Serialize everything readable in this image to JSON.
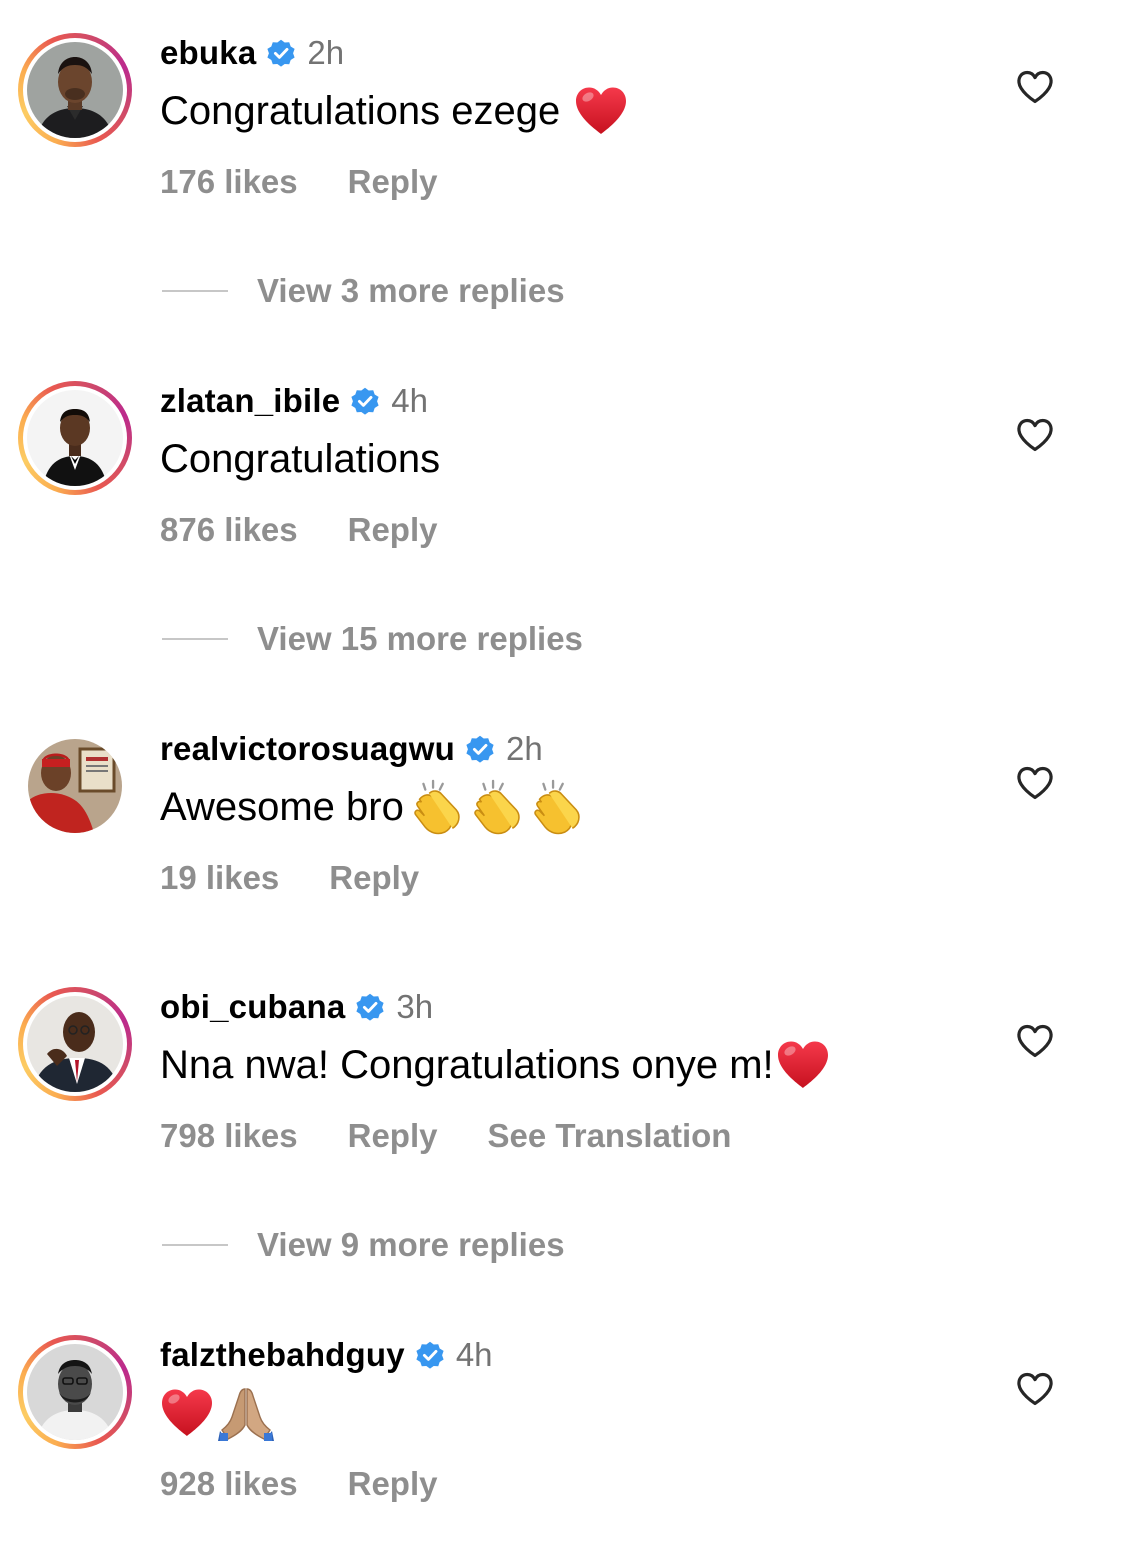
{
  "comments": [
    {
      "username": "ebuka",
      "time": "2h",
      "text": "Congratulations ezege",
      "likes": "176 likes",
      "reply_label": "Reply",
      "view_replies": "View 3 more replies"
    },
    {
      "username": "zlatan_ibile",
      "time": "4h",
      "text": "Congratulations",
      "likes": "876 likes",
      "reply_label": "Reply",
      "view_replies": "View 15 more replies"
    },
    {
      "username": "realvictorosuagwu",
      "time": "2h",
      "text": "Awesome bro",
      "likes": "19 likes",
      "reply_label": "Reply"
    },
    {
      "username": "obi_cubana",
      "time": "3h",
      "text": "Nna nwa! Congratulations onye m!",
      "likes": "798 likes",
      "reply_label": "Reply",
      "translation_label": "See Translation",
      "view_replies": "View 9 more replies"
    },
    {
      "username": "falzthebahdguy",
      "time": "4h",
      "text": "",
      "likes": "928 likes",
      "reply_label": "Reply"
    }
  ],
  "icons": {
    "verified": "verified-badge-icon",
    "like": "heart-outline-icon",
    "emoji_heart": "red-heart-emoji",
    "emoji_clap": "clapping-hands-emoji",
    "emoji_pray": "folded-hands-emoji"
  },
  "colors": {
    "verified_blue": "#3897f0",
    "secondary_text": "#8e8e8e",
    "time_text": "#737373",
    "emoji_red": "#e0162b"
  }
}
